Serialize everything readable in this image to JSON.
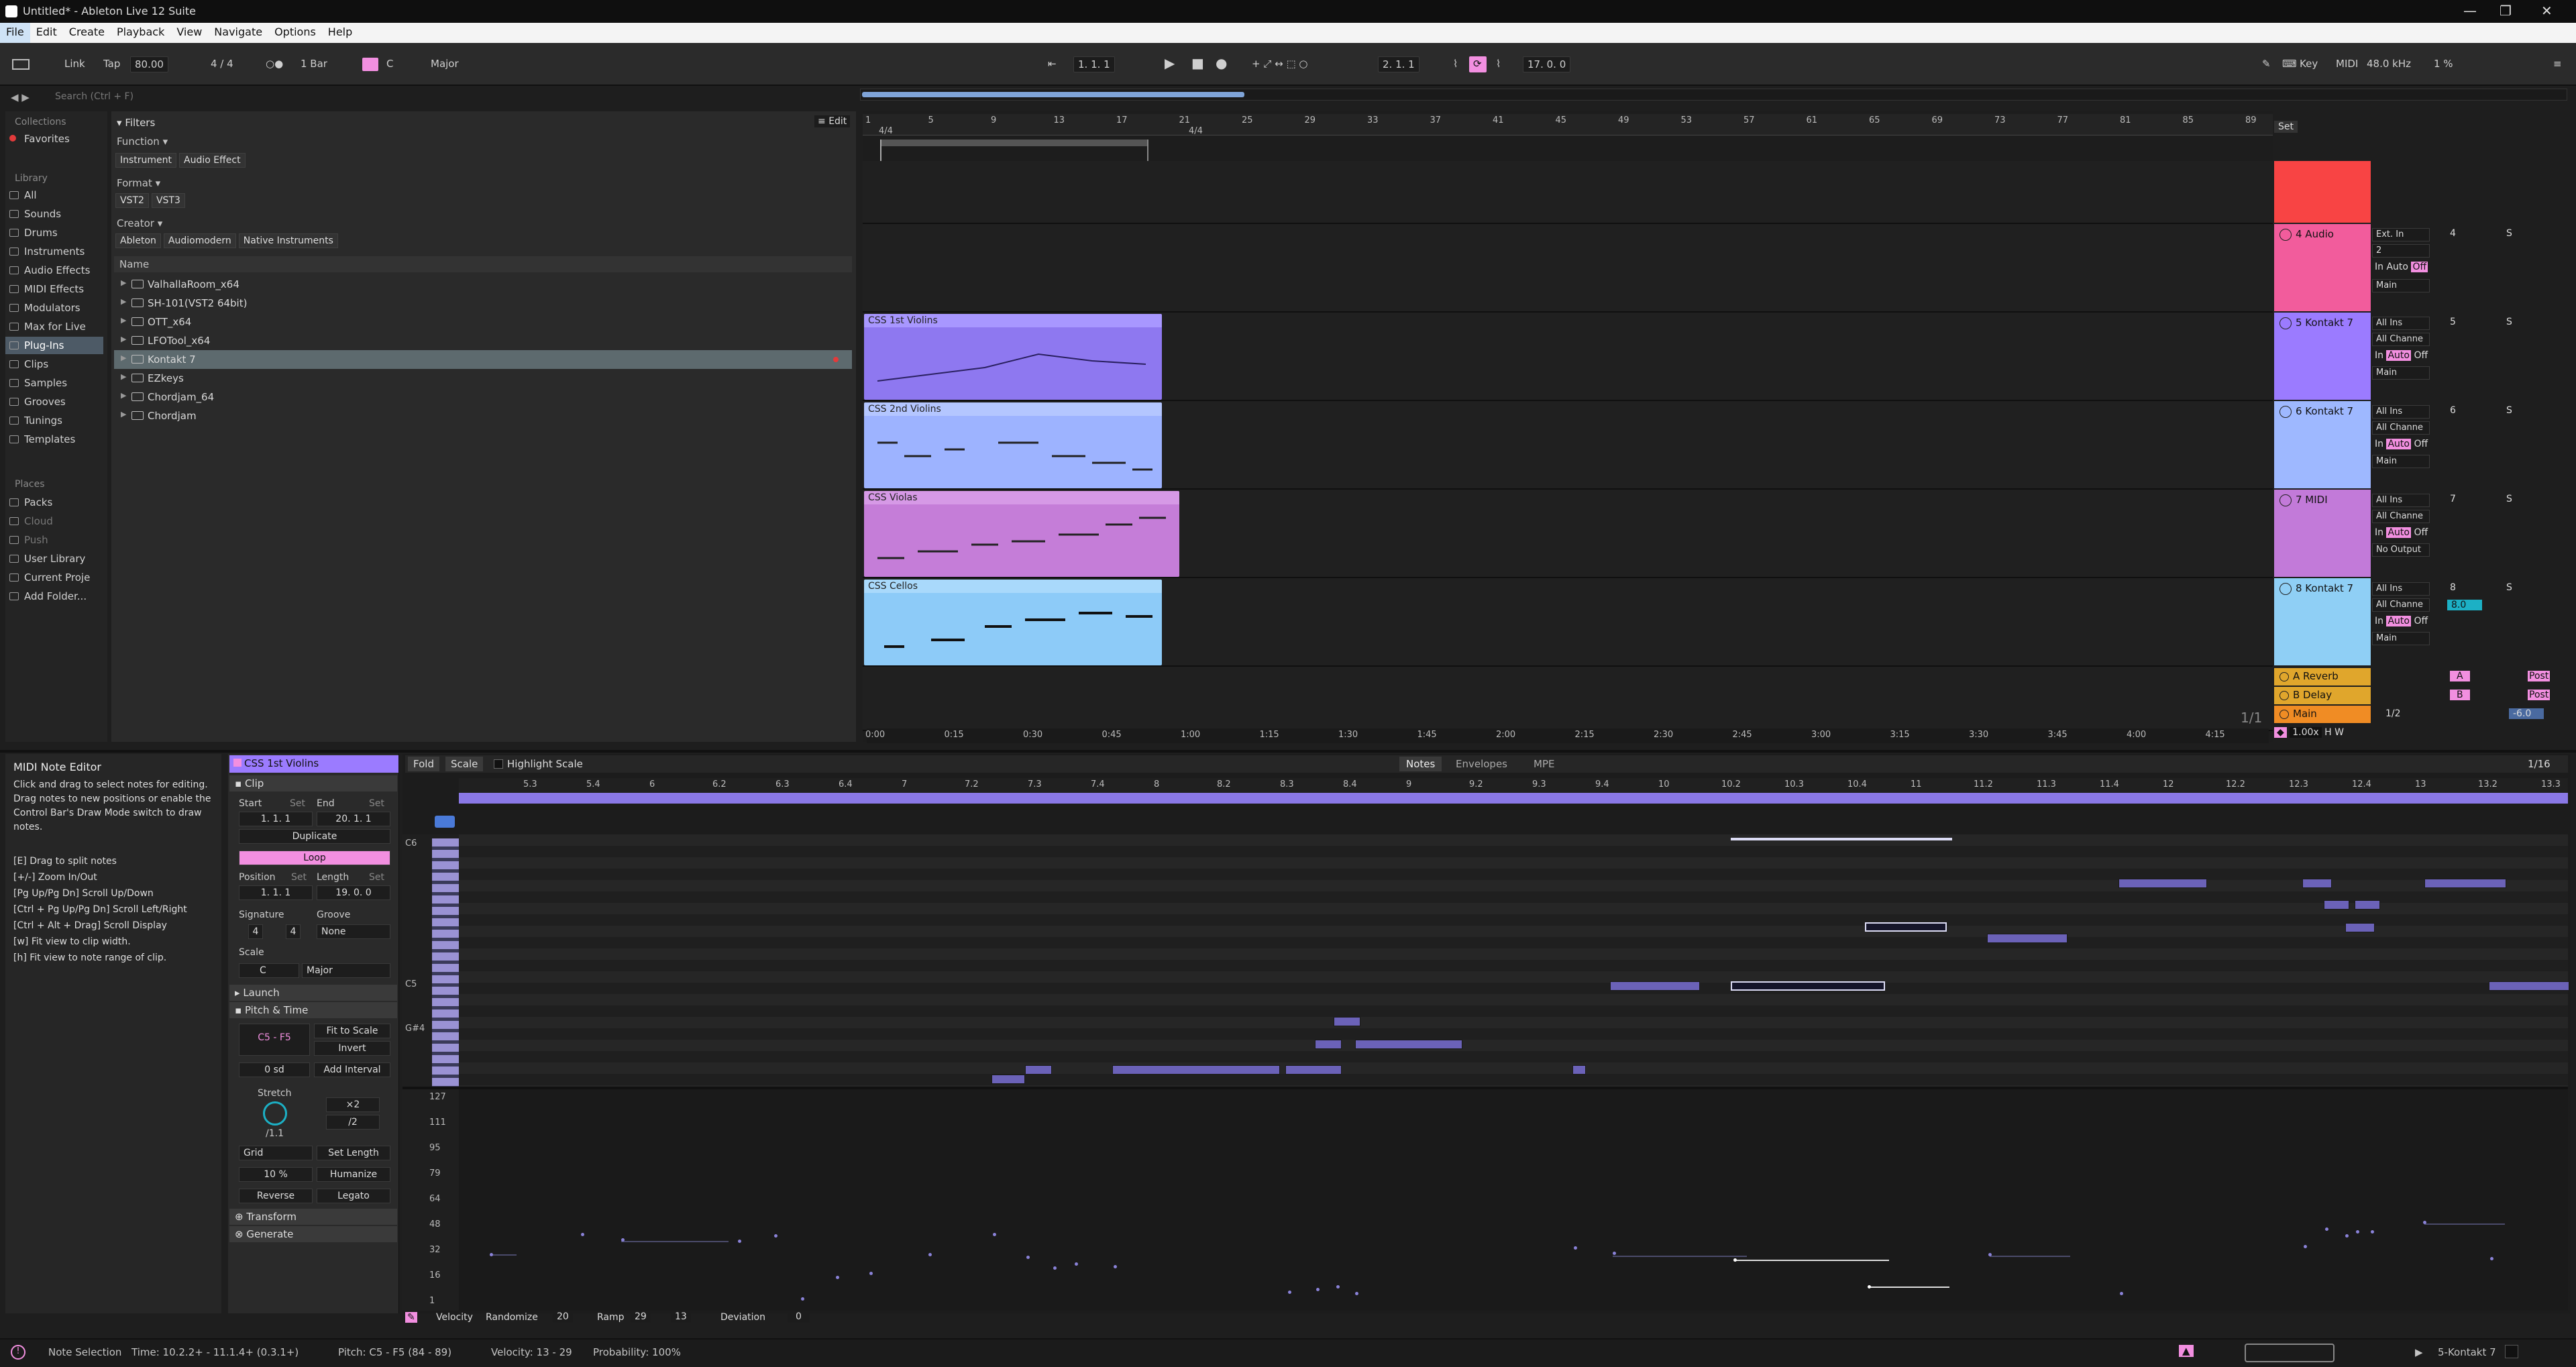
{
  "window": {
    "title": "Untitled* - Ableton Live 12 Suite",
    "minimize": "—",
    "maximize": "❐",
    "close": "✕"
  },
  "menu": [
    "File",
    "Edit",
    "Create",
    "Playback",
    "View",
    "Navigate",
    "Options",
    "Help"
  ],
  "control": {
    "link": "Link",
    "tap": "Tap",
    "tempo": "80.00",
    "signature": "4 / 4",
    "quantize": "1 Bar",
    "key": "C",
    "scale": "Major",
    "position": "1.  1.  1",
    "loop_start": "2.  1.  1",
    "loop_length": "17.  0.  0",
    "key_label": "Key",
    "midi_label": "MIDI",
    "sample_rate": "48.0 kHz",
    "cpu": "1 %"
  },
  "browser": {
    "search_placeholder": "Search (Ctrl + F)",
    "collections_header": "Collections",
    "favorites": "Favorites",
    "library_header": "Library",
    "library": [
      "All",
      "Sounds",
      "Drums",
      "Instruments",
      "Audio Effects",
      "MIDI Effects",
      "Modulators",
      "Max for Live",
      "Plug-Ins",
      "Clips",
      "Samples",
      "Grooves",
      "Tunings",
      "Templates"
    ],
    "places_header": "Places",
    "places": [
      "Packs",
      "Cloud",
      "Push",
      "User Library",
      "Current Proje",
      "Add Folder..."
    ],
    "filters": "Filters",
    "edit": "Edit",
    "function_label": "Function",
    "function_tags": [
      "Instrument",
      "Audio Effect"
    ],
    "format_label": "Format",
    "format_tags": [
      "VST2",
      "VST3"
    ],
    "creator_label": "Creator",
    "creator_tags": [
      "Ableton",
      "Audiomodern",
      "Native Instruments"
    ],
    "name_header": "Name",
    "files": [
      "ValhallaRoom_x64",
      "SH-101(VST2 64bit)",
      "OTT_x64",
      "LFOTool_x64",
      "Kontakt 7",
      "EZkeys",
      "Chordjam_64",
      "Chordjam"
    ]
  },
  "arrangement": {
    "bars": [
      "1",
      "5",
      "9",
      "13",
      "17",
      "21",
      "25",
      "29",
      "33",
      "37",
      "41",
      "45",
      "49",
      "53",
      "57",
      "61",
      "65",
      "69",
      "73",
      "77",
      "81",
      "85",
      "89"
    ],
    "sig1": "4/4",
    "sig2": "4/4",
    "set": "Set",
    "times": [
      "0:00",
      "0:15",
      "0:30",
      "0:45",
      "1:00",
      "1:15",
      "1:30",
      "1:45",
      "2:00",
      "2:15",
      "2:30",
      "2:45",
      "3:00",
      "3:15",
      "3:30",
      "3:45",
      "4:00",
      "4:15"
    ],
    "page": "1/1",
    "zoom": "1.00x",
    "h": "H",
    "w": "W",
    "clips": [
      {
        "name": "CSS 1st Violins"
      },
      {
        "name": "CSS 2nd Violins"
      },
      {
        "name": "CSS Violas"
      },
      {
        "name": "CSS Cellos"
      }
    ],
    "tracks": [
      {
        "name": "4 Audio",
        "color": "#f25c9c",
        "input": "Ext. In",
        "ch": "2",
        "num": "4",
        "out": "Main"
      },
      {
        "name": "5 Kontakt 7",
        "color": "#9b7bff",
        "input": "All Ins",
        "ch": "All Channe",
        "num": "5",
        "out": "Main"
      },
      {
        "name": "6 Kontakt 7",
        "color": "#9eb8ff",
        "input": "All Ins",
        "ch": "All Channe",
        "num": "6",
        "out": "Main"
      },
      {
        "name": "7 MIDI",
        "color": "#c27ad9",
        "input": "All Ins",
        "ch": "All Channe",
        "num": "7",
        "out": "No Output"
      },
      {
        "name": "8 Kontakt 7",
        "color": "#8fcff5",
        "input": "All Ins",
        "ch": "All Channe",
        "num": "8",
        "out": "Main",
        "vol": "8.0"
      }
    ],
    "returns": [
      {
        "name": "A Reverb",
        "letter": "A"
      },
      {
        "name": "B Delay",
        "letter": "B"
      },
      {
        "name": "Main",
        "val": "1/2",
        "vol": "-6.0"
      }
    ],
    "labels": {
      "in": "In",
      "auto": "Auto",
      "off": "Off",
      "inf": "-∞",
      "c": "C",
      "s": "S",
      "post": "Post",
      "main": "Main",
      "zero": "0"
    }
  },
  "info": {
    "title": "MIDI Note Editor",
    "body": "Click and drag to select notes for editing. Drag notes to new positions or enable the Control Bar's Draw Mode switch to draw notes.",
    "shortcuts": [
      "[E] Drag to split notes",
      "[+/-] Zoom In/Out",
      "[Pg Up/Pg Dn] Scroll Up/Down",
      "[Ctrl + Pg Up/Pg Dn] Scroll Left/Right",
      "[Ctrl + Alt + Drag] Scroll Display",
      "[w] Fit view to clip width.",
      "[h] Fit view to note range of clip."
    ]
  },
  "clippanel": {
    "name": "CSS 1st Violins",
    "clip": "Clip",
    "start": "Start",
    "set": "Set",
    "end": "End",
    "start_val": "1.  1.  1",
    "end_val": "20.  1.  1",
    "duplicate": "Duplicate",
    "loop": "Loop",
    "position": "Position",
    "length": "Length",
    "pos_val": "1.  1.  1",
    "len_val": "19.  0.  0",
    "signature": "Signature",
    "groove": "Groove",
    "sig_num": "4",
    "sig_den": "4",
    "groove_val": "None",
    "scale": "Scale",
    "key": "C",
    "mode": "Major",
    "launch": "Launch",
    "pitch_time": "Pitch & Time",
    "range": "C5 - F5",
    "fit": "Fit to Scale",
    "invert": "Invert",
    "sd": "0 sd",
    "add_interval": "Add Interval",
    "stretch": "Stretch",
    "x2": "×2",
    "half": "/2",
    "ratio": "/1.1",
    "grid": "Grid",
    "set_length": "Set Length",
    "percent": "10 %",
    "humanize": "Humanize",
    "reverse": "Reverse",
    "legato": "Legato",
    "transform": "Transform",
    "generate": "Generate"
  },
  "editor": {
    "fold": "Fold",
    "scale": "Scale",
    "highlight": "Highlight Scale",
    "tabs": [
      "Notes",
      "Envelopes",
      "MPE"
    ],
    "grid": "1/16",
    "ruler": [
      "5.3",
      "5.4",
      "6",
      "6.2",
      "6.3",
      "6.4",
      "7",
      "7.2",
      "7.3",
      "7.4",
      "8",
      "8.2",
      "8.3",
      "8.4",
      "9",
      "9.2",
      "9.3",
      "9.4",
      "10",
      "10.2",
      "10.3",
      "10.4",
      "11",
      "11.2",
      "11.3",
      "11.4",
      "12",
      "12.2",
      "12.3",
      "12.4",
      "13",
      "13.2",
      "13.3"
    ],
    "keys": [
      "C6",
      "C5",
      "G#4"
    ],
    "vel_ticks": [
      "127",
      "111",
      "95",
      "79",
      "64",
      "48",
      "32",
      "16",
      "1"
    ],
    "velocity": "Velocity",
    "randomize": "Randomize",
    "rand_val": "20",
    "ramp": "Ramp",
    "ramp1": "29",
    "ramp2": "13",
    "deviation": "Deviation",
    "dev_val": "0"
  },
  "status": {
    "sel": "Note Selection",
    "time": "Time: 10.2.2+ - 11.1.4+ (0.3.1+)",
    "pitch": "Pitch: C5 - F5 (84 - 89)",
    "velocity": "Velocity: 13 - 29",
    "prob": "Probability: 100%",
    "track": "5-Kontakt 7"
  }
}
